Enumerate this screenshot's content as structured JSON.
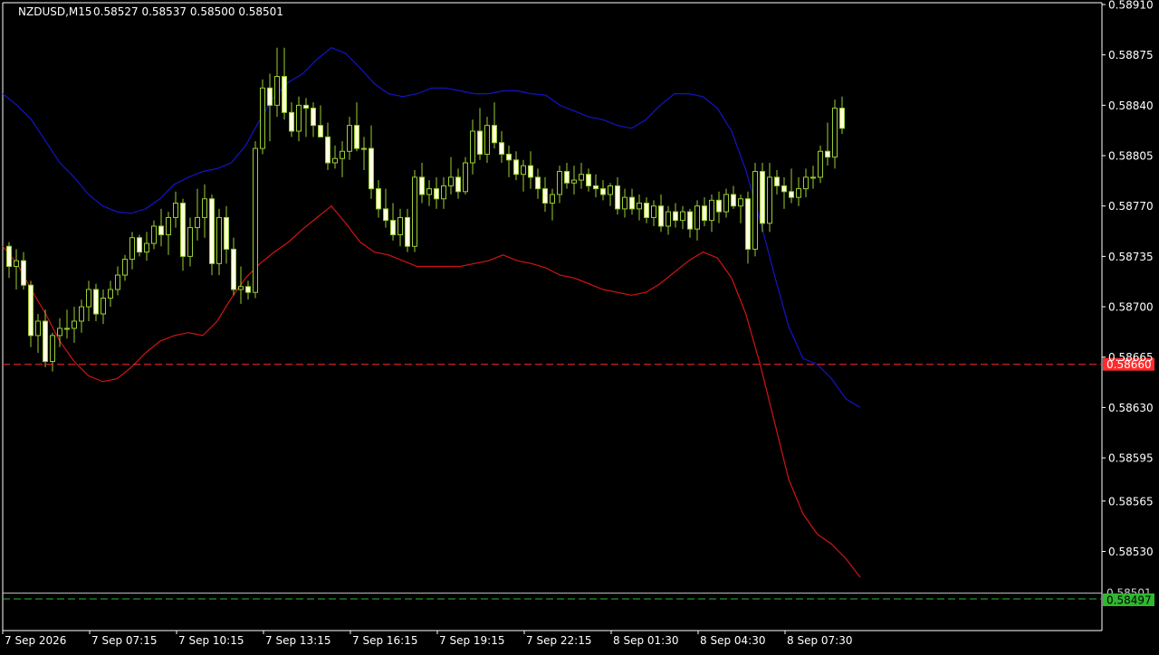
{
  "header": {
    "symbol_timeframe": "NZDUSD,M15",
    "ohlc": "0.58527 0.58537 0.58500 0.58501"
  },
  "colors": {
    "background": "#000000",
    "axis": "#ffffff",
    "candle": "#9acd32",
    "candle_bull_body": "#000000",
    "candle_bear_body": "#ffffe0",
    "upper_band": "#1414c8",
    "lower_band": "#d21414",
    "red_level": "#ff2a2a",
    "green_level": "#2db82d",
    "bid_line": "#c8c8c8"
  },
  "chart_data": {
    "type": "candlestick",
    "title": "NZDUSD,M15",
    "ylim": [
      0.58497,
      0.5891
    ],
    "y_ticks": [
      "0.58910",
      "0.58875",
      "0.58840",
      "0.58805",
      "0.58770",
      "0.58735",
      "0.58700",
      "0.58665",
      "0.58630",
      "0.58595",
      "0.58565",
      "0.58530"
    ],
    "x_ticks": [
      "7 Sep 2026",
      "7 Sep 07:15",
      "7 Sep 10:15",
      "7 Sep 13:15",
      "7 Sep 16:15",
      "7 Sep 19:15",
      "7 Sep 22:15",
      "8 Sep 01:30",
      "8 Sep 04:30",
      "8 Sep 07:30"
    ],
    "bar_count": 118,
    "candles": [
      [
        0.58742,
        0.58745,
        0.5872,
        0.58728
      ],
      [
        0.58728,
        0.5874,
        0.58712,
        0.58732
      ],
      [
        0.58732,
        0.58738,
        0.58712,
        0.58715
      ],
      [
        0.58715,
        0.58718,
        0.58672,
        0.5868
      ],
      [
        0.5868,
        0.58695,
        0.58668,
        0.5869
      ],
      [
        0.5869,
        0.58698,
        0.58658,
        0.58662
      ],
      [
        0.58662,
        0.58682,
        0.58655,
        0.5868
      ],
      [
        0.5868,
        0.58692,
        0.58672,
        0.58685
      ],
      [
        0.58685,
        0.58698,
        0.58678,
        0.58685
      ],
      [
        0.58685,
        0.587,
        0.58675,
        0.5869
      ],
      [
        0.5869,
        0.58705,
        0.58682,
        0.587
      ],
      [
        0.587,
        0.58718,
        0.5869,
        0.58712
      ],
      [
        0.58712,
        0.58716,
        0.5869,
        0.58695
      ],
      [
        0.58695,
        0.58712,
        0.58688,
        0.58706
      ],
      [
        0.58706,
        0.58718,
        0.587,
        0.58712
      ],
      [
        0.58712,
        0.58728,
        0.58708,
        0.58722
      ],
      [
        0.58722,
        0.58736,
        0.58718,
        0.58733
      ],
      [
        0.58733,
        0.58752,
        0.58726,
        0.58748
      ],
      [
        0.58748,
        0.5875,
        0.58735,
        0.58738
      ],
      [
        0.58738,
        0.58752,
        0.58732,
        0.58744
      ],
      [
        0.58744,
        0.5876,
        0.5874,
        0.58756
      ],
      [
        0.58756,
        0.58768,
        0.58742,
        0.5875
      ],
      [
        0.5875,
        0.58766,
        0.58736,
        0.58762
      ],
      [
        0.58762,
        0.5878,
        0.58755,
        0.58772
      ],
      [
        0.58772,
        0.58775,
        0.58725,
        0.58735
      ],
      [
        0.58735,
        0.58762,
        0.58728,
        0.58755
      ],
      [
        0.58755,
        0.58782,
        0.58746,
        0.58762
      ],
      [
        0.58762,
        0.58785,
        0.58748,
        0.58775
      ],
      [
        0.58775,
        0.58778,
        0.58722,
        0.5873
      ],
      [
        0.5873,
        0.58768,
        0.58722,
        0.58762
      ],
      [
        0.58762,
        0.5877,
        0.5873,
        0.5874
      ],
      [
        0.5874,
        0.58748,
        0.58708,
        0.58712
      ],
      [
        0.58712,
        0.58728,
        0.58702,
        0.58714
      ],
      [
        0.58714,
        0.58718,
        0.58705,
        0.5871
      ],
      [
        0.5871,
        0.58815,
        0.58706,
        0.5881
      ],
      [
        0.5881,
        0.58858,
        0.58806,
        0.58852
      ],
      [
        0.58852,
        0.58862,
        0.58815,
        0.5884
      ],
      [
        0.5884,
        0.5888,
        0.58832,
        0.5886
      ],
      [
        0.5886,
        0.5888,
        0.5883,
        0.58835
      ],
      [
        0.58835,
        0.58842,
        0.58818,
        0.58822
      ],
      [
        0.58822,
        0.58846,
        0.58815,
        0.5884
      ],
      [
        0.5884,
        0.58845,
        0.58818,
        0.58838
      ],
      [
        0.58838,
        0.58842,
        0.58818,
        0.58826
      ],
      [
        0.58826,
        0.5884,
        0.5882,
        0.58818
      ],
      [
        0.58818,
        0.58828,
        0.58795,
        0.588
      ],
      [
        0.588,
        0.58812,
        0.58796,
        0.58803
      ],
      [
        0.58803,
        0.58815,
        0.5879,
        0.58808
      ],
      [
        0.58808,
        0.58832,
        0.58802,
        0.58826
      ],
      [
        0.58826,
        0.58842,
        0.58808,
        0.5881
      ],
      [
        0.5881,
        0.58818,
        0.58795,
        0.5881
      ],
      [
        0.5881,
        0.58826,
        0.58775,
        0.58782
      ],
      [
        0.58782,
        0.58788,
        0.58762,
        0.58768
      ],
      [
        0.58768,
        0.58782,
        0.58755,
        0.5876
      ],
      [
        0.5876,
        0.58772,
        0.58746,
        0.5875
      ],
      [
        0.5875,
        0.58768,
        0.58742,
        0.58762
      ],
      [
        0.58762,
        0.58768,
        0.58738,
        0.58742
      ],
      [
        0.58742,
        0.58795,
        0.58738,
        0.5879
      ],
      [
        0.5879,
        0.588,
        0.58772,
        0.58778
      ],
      [
        0.58778,
        0.58788,
        0.5877,
        0.58782
      ],
      [
        0.58782,
        0.5879,
        0.58768,
        0.58775
      ],
      [
        0.58775,
        0.5879,
        0.58768,
        0.58784
      ],
      [
        0.58784,
        0.58804,
        0.58778,
        0.5879
      ],
      [
        0.5879,
        0.58796,
        0.58775,
        0.5878
      ],
      [
        0.5878,
        0.58804,
        0.58778,
        0.588
      ],
      [
        0.588,
        0.5883,
        0.58792,
        0.58822
      ],
      [
        0.58822,
        0.58838,
        0.58802,
        0.58806
      ],
      [
        0.58806,
        0.58832,
        0.588,
        0.58826
      ],
      [
        0.58826,
        0.58842,
        0.5881,
        0.58814
      ],
      [
        0.58814,
        0.58822,
        0.588,
        0.58806
      ],
      [
        0.58806,
        0.58812,
        0.5879,
        0.58802
      ],
      [
        0.58802,
        0.58808,
        0.58788,
        0.58792
      ],
      [
        0.58792,
        0.58802,
        0.5878,
        0.58798
      ],
      [
        0.58798,
        0.58808,
        0.58782,
        0.5879
      ],
      [
        0.5879,
        0.58796,
        0.58775,
        0.58782
      ],
      [
        0.58782,
        0.5879,
        0.58766,
        0.58772
      ],
      [
        0.58772,
        0.58782,
        0.5876,
        0.58778
      ],
      [
        0.58778,
        0.58798,
        0.58772,
        0.58794
      ],
      [
        0.58794,
        0.588,
        0.58782,
        0.58786
      ],
      [
        0.58786,
        0.58798,
        0.58778,
        0.58788
      ],
      [
        0.58788,
        0.588,
        0.58782,
        0.58792
      ],
      [
        0.58792,
        0.58796,
        0.5878,
        0.58784
      ],
      [
        0.58784,
        0.58792,
        0.58776,
        0.58782
      ],
      [
        0.58782,
        0.58788,
        0.58774,
        0.58778
      ],
      [
        0.58778,
        0.58786,
        0.5877,
        0.58784
      ],
      [
        0.58784,
        0.5879,
        0.58764,
        0.58768
      ],
      [
        0.58768,
        0.58782,
        0.58762,
        0.58776
      ],
      [
        0.58776,
        0.58782,
        0.58764,
        0.58768
      ],
      [
        0.58768,
        0.58778,
        0.5876,
        0.58772
      ],
      [
        0.58772,
        0.58776,
        0.58758,
        0.58762
      ],
      [
        0.58762,
        0.58774,
        0.58756,
        0.5877
      ],
      [
        0.5877,
        0.58778,
        0.58752,
        0.58756
      ],
      [
        0.58756,
        0.5877,
        0.5875,
        0.58766
      ],
      [
        0.58766,
        0.58772,
        0.58755,
        0.5876
      ],
      [
        0.5876,
        0.5877,
        0.58754,
        0.58766
      ],
      [
        0.58766,
        0.58768,
        0.58748,
        0.58754
      ],
      [
        0.58754,
        0.58774,
        0.58746,
        0.5877
      ],
      [
        0.5877,
        0.58776,
        0.58756,
        0.5876
      ],
      [
        0.5876,
        0.58778,
        0.58752,
        0.58774
      ],
      [
        0.58774,
        0.5878,
        0.58758,
        0.58766
      ],
      [
        0.58766,
        0.58782,
        0.58762,
        0.58778
      ],
      [
        0.58778,
        0.58784,
        0.58768,
        0.5877
      ],
      [
        0.5877,
        0.58778,
        0.58758,
        0.58775
      ],
      [
        0.58775,
        0.5878,
        0.5873,
        0.5874
      ],
      [
        0.5874,
        0.588,
        0.58735,
        0.58794
      ],
      [
        0.58794,
        0.588,
        0.58752,
        0.58758
      ],
      [
        0.58758,
        0.588,
        0.58752,
        0.5879
      ],
      [
        0.5879,
        0.58795,
        0.58778,
        0.58784
      ],
      [
        0.58784,
        0.5879,
        0.58768,
        0.5878
      ],
      [
        0.5878,
        0.58796,
        0.58772,
        0.58776
      ],
      [
        0.58776,
        0.5879,
        0.5877,
        0.58782
      ],
      [
        0.58782,
        0.58796,
        0.58776,
        0.5879
      ],
      [
        0.5879,
        0.58798,
        0.58782,
        0.5879
      ],
      [
        0.5879,
        0.58812,
        0.58786,
        0.58808
      ],
      [
        0.58808,
        0.58828,
        0.58798,
        0.58804
      ],
      [
        0.58804,
        0.58844,
        0.58796,
        0.58838
      ],
      [
        0.58838,
        0.58846,
        0.5882,
        0.58824
      ]
    ]
  },
  "bands": {
    "upper": [
      0.58848,
      0.5884,
      0.5883,
      0.58815,
      0.588,
      0.5879,
      0.58778,
      0.5877,
      0.58766,
      0.58765,
      0.58768,
      0.58775,
      0.58785,
      0.5879,
      0.58794,
      0.58796,
      0.588,
      0.58812,
      0.5883,
      0.58846,
      0.58856,
      0.58862,
      0.58872,
      0.5888,
      0.58876,
      0.58866,
      0.58855,
      0.58848,
      0.58846,
      0.58848,
      0.58852,
      0.58852,
      0.5885,
      0.58848,
      0.58848,
      0.5885,
      0.5885,
      0.58848,
      0.58847,
      0.5884,
      0.58836,
      0.58832,
      0.5883,
      0.58826,
      0.58824,
      0.5883,
      0.5884,
      0.58848,
      0.58848,
      0.58846,
      0.58838,
      0.58822,
      0.58795,
      0.5876,
      0.58722,
      0.58686,
      0.58664,
      0.5866,
      0.5865,
      0.58636,
      0.5863
    ],
    "lower": [
      0.58742,
      0.5873,
      0.58712,
      0.58695,
      0.58676,
      0.58662,
      0.58652,
      0.58648,
      0.5865,
      0.58658,
      0.58668,
      0.58676,
      0.5868,
      0.58682,
      0.5868,
      0.5869,
      0.58706,
      0.5872,
      0.5873,
      0.58738,
      0.58745,
      0.58754,
      0.58762,
      0.5877,
      0.58758,
      0.58745,
      0.58738,
      0.58736,
      0.58732,
      0.58728,
      0.58728,
      0.58728,
      0.58728,
      0.5873,
      0.58732,
      0.58736,
      0.58732,
      0.5873,
      0.58727,
      0.58722,
      0.5872,
      0.58716,
      0.58712,
      0.5871,
      0.58708,
      0.5871,
      0.58716,
      0.58724,
      0.58732,
      0.58738,
      0.58734,
      0.5872,
      0.58695,
      0.5866,
      0.5862,
      0.5858,
      0.58556,
      0.58542,
      0.58535,
      0.58525,
      0.58512
    ]
  },
  "levels": {
    "red_value": "0.58660",
    "red_num": 0.5866,
    "green_value": "0.58497",
    "green_num": 0.58497,
    "bid_value": "0.58501",
    "bid_num": 0.58501
  }
}
